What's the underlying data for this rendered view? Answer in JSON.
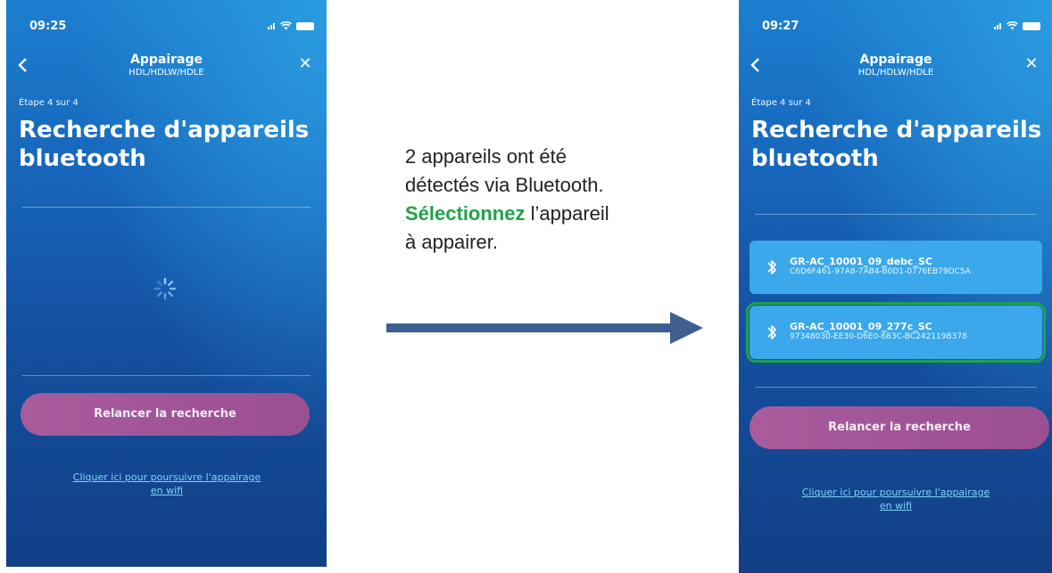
{
  "left_screen": {
    "status": {
      "time": "09:25"
    },
    "nav": {
      "title": "Appairage",
      "subtitle": "HDL/HDLW/HDLE"
    },
    "step": "Étape 4 sur 4",
    "heading_line1": "Recherche d'appareils",
    "heading_line2": "bluetooth",
    "state": "searching",
    "cta_label": "Relancer la recherche",
    "wifi_link_line1": "Cliquer ici pour poursuivre l'appairage",
    "wifi_link_line2": "en wifi"
  },
  "right_screen": {
    "status": {
      "time": "09:27"
    },
    "nav": {
      "title": "Appairage",
      "subtitle": "HDL/HDLW/HDLE"
    },
    "step": "Étape 4 sur 4",
    "heading_line1": "Recherche d'appareils",
    "heading_line2": "bluetooth",
    "devices": [
      {
        "name": "GR-AC_10001_09_debc_SC",
        "uuid": "C6D6F461-97A8-7AB4-B0D1-0776EB79DC5A",
        "selected": false
      },
      {
        "name": "GR-AC_10001_09_277c_SC",
        "uuid": "97348030-EE30-D6E0-683C-BC242119B378",
        "selected": true
      }
    ],
    "cta_label": "Relancer la recherche",
    "wifi_link_line1": "Cliquer ici pour poursuivre l'appairage",
    "wifi_link_line2": "en wifi"
  },
  "annotation": {
    "line1": "2 appareils ont été",
    "line2": "détectés via Bluetooth.",
    "highlight": "Sélectionnez",
    "line3_rest": " l’appareil",
    "line4": "à appairer."
  },
  "colors": {
    "highlight": "#1fa347",
    "selected_outline": "#1ea24b",
    "arrow": "#3f5f8f",
    "cta": "#a85c9c"
  },
  "icons": [
    "chevron-left-icon",
    "close-icon",
    "bluetooth-icon",
    "spinner-icon",
    "signal-icon",
    "wifi-icon",
    "battery-icon",
    "arrow-right-icon"
  ]
}
